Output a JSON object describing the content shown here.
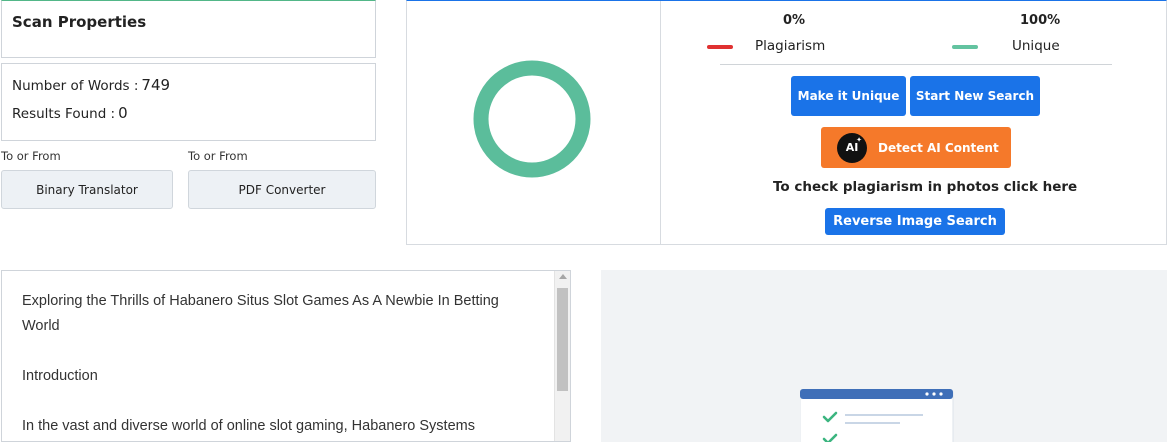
{
  "scan": {
    "title": "Scan Properties"
  },
  "stats": {
    "words_label": "Number of Words :",
    "words_value": "749",
    "results_label": "Results Found :",
    "results_value": "0"
  },
  "tools": [
    {
      "label": "To or From",
      "button": "Binary Translator"
    },
    {
      "label": "To or From",
      "button": "PDF Converter"
    }
  ],
  "result": {
    "plagiarism_percent": 0,
    "unique_percent": 100,
    "plagiarism_pct_text": "0%",
    "unique_pct_text": "100%",
    "plagiarism_label": "Plagiarism",
    "unique_label": "Unique",
    "colors": {
      "plagiarism": "#e03131",
      "unique": "#5bbd9b",
      "primary": "#1a73e8",
      "orange": "#f5792a"
    },
    "make_unique_button": "Make it Unique",
    "new_search_button": "Start New Search",
    "detect_ai_button": "Detect AI Content",
    "ai_badge": "AI",
    "ai_badge_icon": "sparkle-icon",
    "photo_hint": "To check plagiarism in photos click here",
    "reverse_search_button": "Reverse Image Search"
  },
  "text": {
    "paragraphs": [
      "Exploring the Thrills of Habanero Situs Slot Games As A Newbie In Betting World",
      "Introduction",
      "In the vast and diverse world of online slot gaming, Habanero Systems"
    ]
  },
  "illustration": {
    "icon": "checklist-window-icon"
  }
}
